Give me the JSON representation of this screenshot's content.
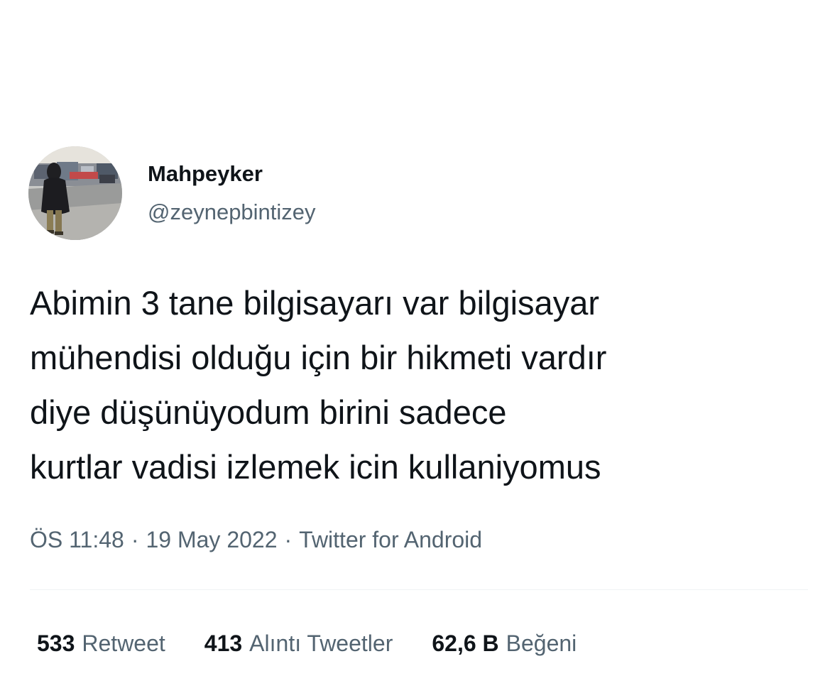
{
  "tweet": {
    "author": {
      "display_name": "Mahpeyker",
      "handle": "@zeynepbintizey"
    },
    "text_lines": [
      "Abimin 3 tane bilgisayarı var bilgisayar",
      "mühendisi olduğu için bir hikmeti vardır",
      "diye düşünüyodum birini sadece",
      "kurtlar vadisi izlemek icin kullaniyomus"
    ],
    "meta": {
      "time": "ÖS 11:48",
      "separator": "·",
      "date": "19 May 2022",
      "source": "Twitter for Android"
    },
    "stats": [
      {
        "count": "533",
        "label": "Retweet"
      },
      {
        "count": "413",
        "label": "Alıntı Tweetler"
      },
      {
        "count": "62,6 B",
        "label": "Beğeni"
      }
    ]
  },
  "colors": {
    "primary_text": "#0f1419",
    "secondary_text": "#536471",
    "divider": "#eff3f4"
  }
}
